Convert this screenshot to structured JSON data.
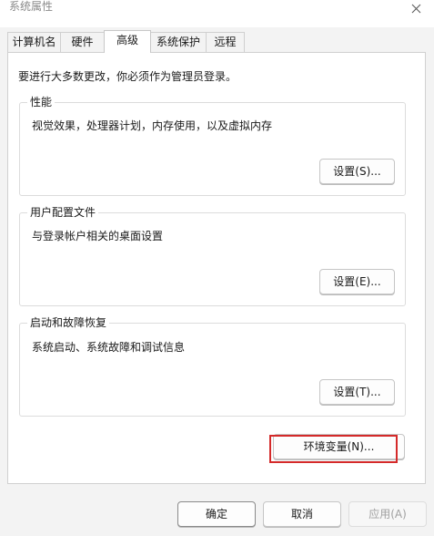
{
  "window": {
    "title": "系统属性",
    "close_icon": "close-icon"
  },
  "tabs": [
    {
      "label": "计算机名",
      "active": false
    },
    {
      "label": "硬件",
      "active": false
    },
    {
      "label": "高级",
      "active": true
    },
    {
      "label": "系统保护",
      "active": false
    },
    {
      "label": "远程",
      "active": false
    }
  ],
  "advanced": {
    "admin_note": "要进行大多数更改，你必须作为管理员登录。",
    "performance": {
      "label": "性能",
      "description": "视觉效果，处理器计划，内存使用，以及虚拟内存",
      "button": "设置(S)..."
    },
    "user_profiles": {
      "label": "用户配置文件",
      "description": "与登录帐户相关的桌面设置",
      "button": "设置(E)..."
    },
    "startup_recovery": {
      "label": "启动和故障恢复",
      "description": "系统启动、系统故障和调试信息",
      "button": "设置(T)..."
    },
    "env_vars_button": "环境变量(N)..."
  },
  "footer": {
    "ok": "确定",
    "cancel": "取消",
    "apply": "应用(A)"
  },
  "colors": {
    "highlight": "#d42a2a",
    "disabled_text": "#a0a0a0"
  }
}
